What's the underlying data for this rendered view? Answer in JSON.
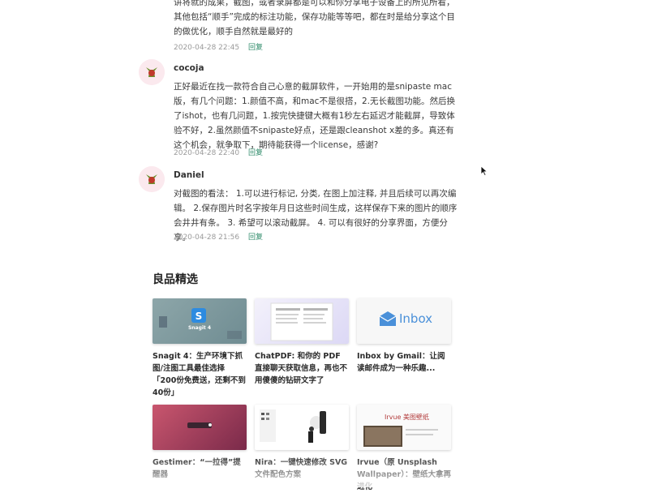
{
  "comments": [
    {
      "author": "",
      "text": "讲将就的成果，截图，或者录屏都是可以和你分享电子设备上的所见所看，其他包括“顺手”完成的标注功能，保存功能等等吧，都在时是给分享这个目的做优化，顺手自然就是最好的",
      "time": "2020-04-28 22:45",
      "reply_label": "回复"
    },
    {
      "author": "cocoja",
      "text": "正好最近在找一款符合自己心意的截屏软件，一开始用的是snipaste mac版，有几个问题：1.颜值不高，和mac不是很搭，2.无长截图功能。然后换了ishot，也有几问题，1.按完快捷键大概有1秒左右延迟才能截屏，导致体验不好，2.虽然颜值不snipaste好点，还是跟cleanshot x差的多。真还有这个机会，就争取下，期待能获得一个license，感谢?",
      "time": "2020-04-28 22:40",
      "reply_label": "回复"
    },
    {
      "author": "Daniel",
      "text": "对截图的看法： 1.可以进行标记, 分类, 在图上加注释, 并且后续可以再次编辑。 2.保存图片时名字按年月日这些时间生成，这样保存下来的图片的顺序会井井有条。 3. 希望可以滚动截屏。 4. 可以有很好的分享界面，方便分享。",
      "time": "2020-04-28 21:56",
      "reply_label": "回复"
    }
  ],
  "picks": {
    "title": "良品精选",
    "items": [
      {
        "title": "Snagit 4：生产环境下抓图/注图工具最佳选择「200份免费送，还剩不到 40份」",
        "thumb_text": "Snagit 4"
      },
      {
        "title": "ChatPDF: 和你的 PDF 直接聊天获取信息，再也不用傻傻的钻研文字了",
        "thumb_text": ""
      },
      {
        "title": "Inbox by Gmail：让阅读邮件成为一种乐趣...",
        "thumb_text": "Inbox"
      },
      {
        "title": "Gestimer：“一拉得”提醒器",
        "thumb_text": ""
      },
      {
        "title": "Nira：一键快速修改 SVG 文件配色方案",
        "thumb_text": ""
      },
      {
        "title": "Irvue（原 Unsplash Wallpaper）：壁纸大拿再进化",
        "thumb_text": "Irvue 美图壁纸"
      }
    ]
  },
  "colors": {
    "reply": "#2e8b6a",
    "meta": "#9a9a9a"
  }
}
